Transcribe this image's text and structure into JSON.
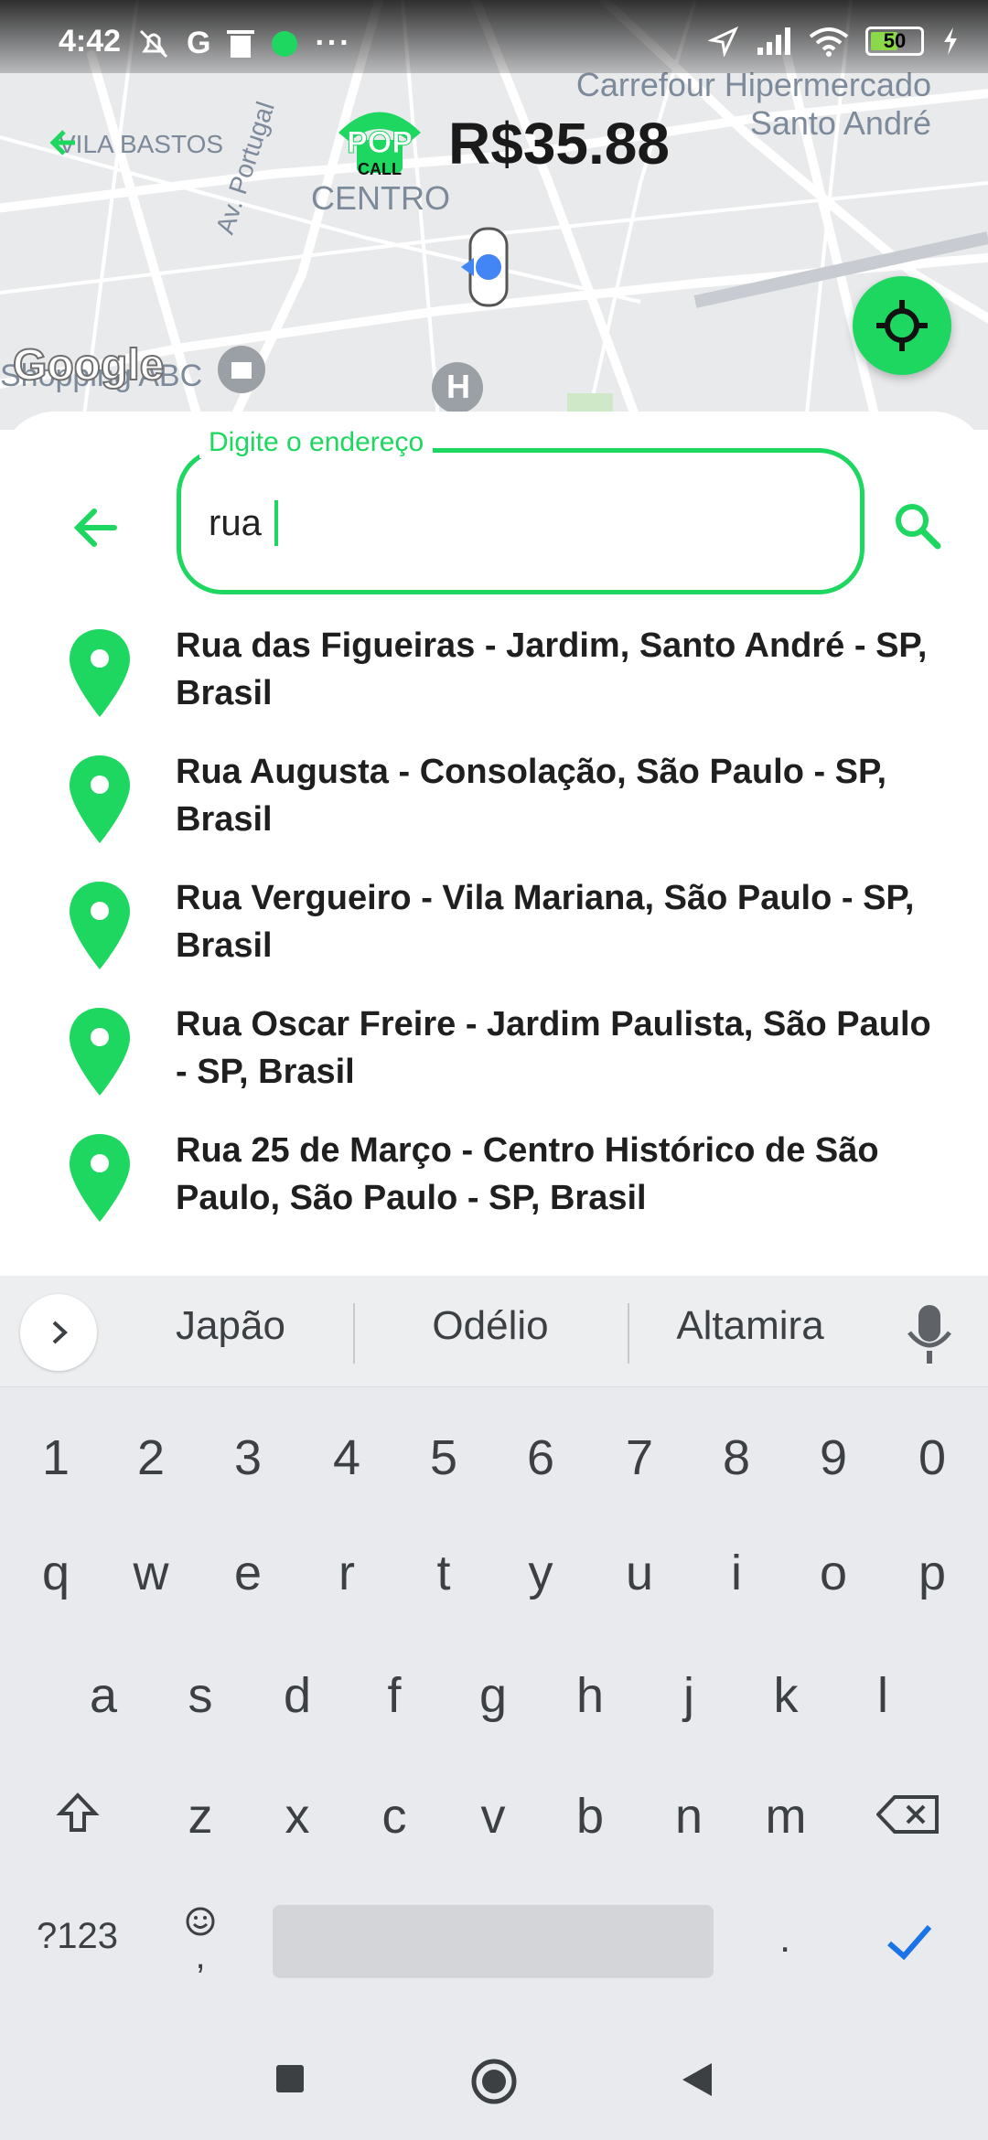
{
  "status_bar": {
    "time": "4:42",
    "battery": "50",
    "icons_left": [
      "mute-icon",
      "google-icon",
      "trash-icon",
      "pop-app-icon",
      "more-dots-icon"
    ],
    "icons_right": [
      "location-arrow-icon",
      "signal-icon",
      "wifi-icon",
      "battery-icon",
      "charging-icon"
    ]
  },
  "map": {
    "labels": {
      "vila_bastos": "VILA BASTOS",
      "centro": "CENTRO",
      "carrefour": "Carrefour Hipermercado\nSanto André",
      "portugal": "Av. Portugal",
      "shopping": "Shopping ABC",
      "hospital": "H"
    },
    "google": "Google",
    "logo": {
      "top": "POP",
      "bottom": "CALL"
    },
    "price": "R$35.88",
    "colors": {
      "accent": "#1ed760",
      "road": "#ffffff",
      "background": "#e9eaec"
    }
  },
  "search": {
    "label": "Digite o endereço",
    "value": "rua"
  },
  "results": [
    {
      "text": "Rua das Figueiras - Jardim, Santo André - SP, Brasil"
    },
    {
      "text": "Rua Augusta - Consolação, São Paulo - SP, Brasil"
    },
    {
      "text": "Rua Vergueiro - Vila Mariana, São Paulo - SP, Brasil"
    },
    {
      "text": "Rua Oscar Freire - Jardim Paulista, São Paulo - SP, Brasil"
    },
    {
      "text": "Rua 25 de Março - Centro Histórico de São Paulo, São Paulo - SP, Brasil"
    }
  ],
  "keyboard": {
    "suggestions": [
      "Japão",
      "Odélio",
      "Altamira"
    ],
    "rows": {
      "numbers": [
        "1",
        "2",
        "3",
        "4",
        "5",
        "6",
        "7",
        "8",
        "9",
        "0"
      ],
      "row1": [
        "q",
        "w",
        "e",
        "r",
        "t",
        "y",
        "u",
        "i",
        "o",
        "p"
      ],
      "row2": [
        "a",
        "s",
        "d",
        "f",
        "g",
        "h",
        "j",
        "k",
        "l"
      ],
      "row3": [
        "z",
        "x",
        "c",
        "v",
        "b",
        "n",
        "m"
      ]
    },
    "symbols_key": "?123",
    "comma_key": ",",
    "period_key": "."
  }
}
